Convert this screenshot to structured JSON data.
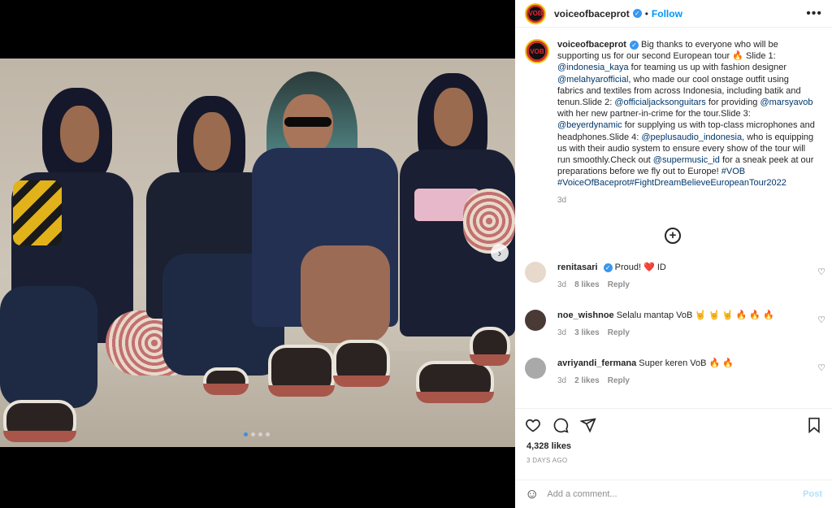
{
  "post": {
    "username": "voiceofbaceprot",
    "avatar_text": "VOB",
    "separator": "•",
    "follow_label": "Follow",
    "more_label": "•••"
  },
  "caption": {
    "username": "voiceofbaceprot",
    "seg1": "Big thanks to everyone who will be supporting us for our second European tour 🔥 Slide 1: ",
    "link1": "@indonesia_kaya",
    "seg2": " for teaming us up with fashion designer ",
    "link2": "@melahyarofficial",
    "seg3": ", who made our cool onstage outfit using fabrics and textiles from across Indonesia, including batik and tenun.Slide 2: ",
    "link3": "@officialjacksonguitars",
    "seg4": " for providing ",
    "link4": "@marsyavob",
    "seg5": " with her new partner-in-crime for the tour.Slide 3: ",
    "link5": "@beyerdynamic",
    "seg6": " for supplying us with top-class microphones and headphones.Slide 4: ",
    "link6": "@peplusaudio_indonesia",
    "seg7": ", who is equipping us with their audio system to ensure every show of the tour will run smoothly.Check out ",
    "link7": "@supermusic_id",
    "seg8": " for a sneak peek at our preparations before we fly out to Europe! ",
    "link8": "#VOB",
    "link9": "#VoiceOfBaceprot#FightDreamBelieveEuropeanTour2022",
    "time": "3d"
  },
  "load_more_label": "+",
  "comments": [
    {
      "username": "renitasari",
      "verified": true,
      "text": "Proud! ❤️ ID",
      "time": "3d",
      "likes": "8 likes",
      "reply": "Reply",
      "avatar_color": "#e7d9cc"
    },
    {
      "username": "noe_wishnoe",
      "verified": false,
      "text": "Selalu mantap VoB 🤘 🤘 🤘 🔥 🔥 🔥",
      "time": "3d",
      "likes": "3 likes",
      "reply": "Reply",
      "avatar_color": "#4a3a35"
    },
    {
      "username": "avriyandi_fermana",
      "verified": false,
      "text": "Super keren VoB 🔥 🔥",
      "time": "3d",
      "likes": "2 likes",
      "reply": "Reply",
      "avatar_color": "#a9a9a9"
    }
  ],
  "stats": {
    "likes": "4,328 likes",
    "date": "3 DAYS AGO"
  },
  "add_comment": {
    "placeholder": "Add a comment...",
    "post_label": "Post",
    "emoji": "☺"
  },
  "media": {
    "next_label": "›",
    "slide_count": 4,
    "current_slide": 1,
    "user_tag_icon": "person-icon"
  }
}
